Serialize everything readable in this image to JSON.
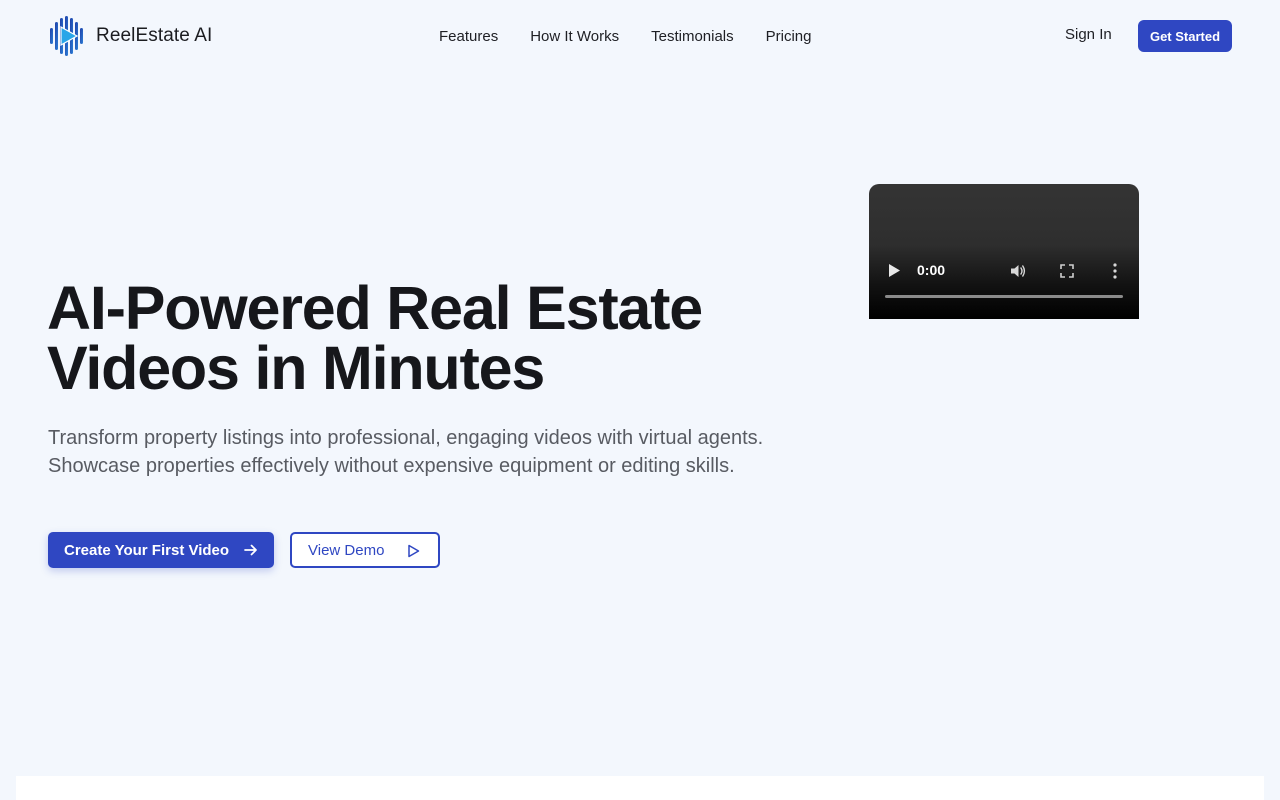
{
  "brand": {
    "name": "ReelEstate AI",
    "accent": "#2f47c2",
    "logo_icon": "play-reel-icon"
  },
  "nav": {
    "items": [
      {
        "label": "Features"
      },
      {
        "label": "How It Works"
      },
      {
        "label": "Testimonials"
      },
      {
        "label": "Pricing"
      }
    ],
    "sign_in": "Sign In",
    "cta": "Get Started"
  },
  "hero": {
    "title_line1": "AI-Powered Real Estate",
    "title_line2": "Videos in Minutes",
    "subtitle": "Transform property listings into professional, engaging videos with virtual agents. Showcase properties effectively without expensive equipment or editing skills.",
    "primary_button": "Create Your First Video",
    "primary_icon": "arrow-right-icon",
    "secondary_button": "View Demo",
    "secondary_icon": "play-outline-icon"
  },
  "video": {
    "time": "0:00",
    "progress": 0,
    "icons": [
      "play-icon",
      "volume-icon",
      "fullscreen-icon",
      "more-vertical-icon"
    ]
  }
}
